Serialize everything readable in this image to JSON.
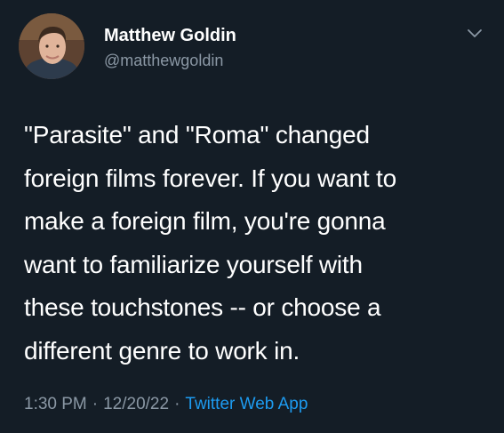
{
  "author": {
    "display_name": "Matthew Goldin",
    "handle": "@matthewgoldin"
  },
  "menu_icon": "chevron-down-icon",
  "avatar_icon": "user-photo",
  "tweet": {
    "lines": [
      "\"Parasite\" and \"Roma\" changed",
      "foreign films forever. If you want to",
      "make a foreign film, you're gonna",
      "want to familiarize yourself with",
      "these touchstones -- or choose a",
      "different genre to work in."
    ]
  },
  "meta": {
    "time": "1:30 PM",
    "separator": "·",
    "date": "12/20/22",
    "source": "Twitter Web App"
  },
  "colors": {
    "background": "#141d26",
    "secondary_text": "#8b98a5",
    "link": "#1d9bf0"
  }
}
